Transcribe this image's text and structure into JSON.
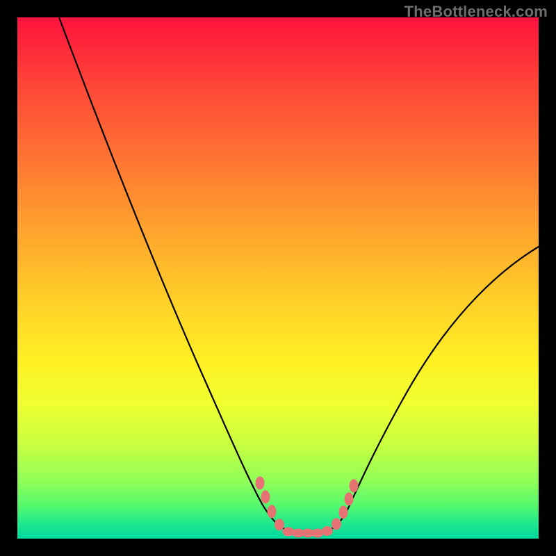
{
  "watermark": "TheBottleneck.com",
  "chart_data": {
    "type": "line",
    "title": "",
    "xlabel": "",
    "ylabel": "",
    "xlim": [
      0,
      100
    ],
    "ylim": [
      0,
      100
    ],
    "grid": false,
    "legend": false,
    "series": [
      {
        "name": "curve",
        "x": [
          8,
          12,
          16,
          20,
          24,
          28,
          32,
          36,
          40,
          44,
          46,
          48,
          50,
          52,
          54,
          56,
          58,
          60,
          62,
          64,
          68,
          74,
          80,
          86,
          92,
          98,
          100
        ],
        "y": [
          100,
          92,
          84,
          76,
          67,
          58,
          49,
          40,
          31,
          20,
          14,
          8,
          4,
          2,
          1,
          1,
          1,
          2,
          4,
          7,
          12,
          20,
          28,
          36,
          44,
          52,
          56
        ]
      }
    ],
    "markers": [
      {
        "x": 46.5,
        "y": 10.5
      },
      {
        "x": 47.5,
        "y": 7.5
      },
      {
        "x": 49.0,
        "y": 4.0
      },
      {
        "x": 51.0,
        "y": 1.8
      },
      {
        "x": 53.0,
        "y": 1.2
      },
      {
        "x": 55.0,
        "y": 1.0
      },
      {
        "x": 57.0,
        "y": 1.2
      },
      {
        "x": 59.0,
        "y": 2.0
      },
      {
        "x": 61.0,
        "y": 3.8
      },
      {
        "x": 62.5,
        "y": 6.5
      },
      {
        "x": 63.8,
        "y": 9.5
      }
    ],
    "marker_color": "#e57373",
    "background_gradient": [
      "#ff143e",
      "#ff8c30",
      "#fff024",
      "#50f870",
      "#00d8a0"
    ]
  }
}
